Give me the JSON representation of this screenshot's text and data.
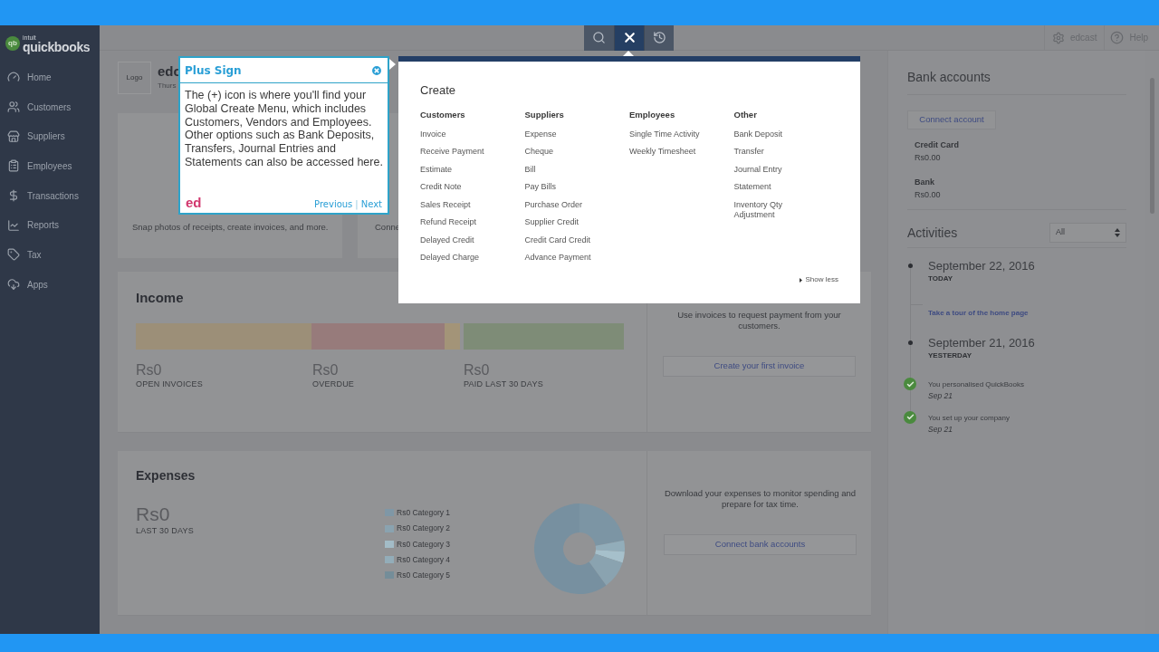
{
  "sidebar": {
    "logo_badge": "qb",
    "logo_small": "intuit",
    "logo": "quickbooks",
    "items": [
      {
        "label": "Home"
      },
      {
        "label": "Customers"
      },
      {
        "label": "Suppliers"
      },
      {
        "label": "Employees"
      },
      {
        "label": "Transactions"
      },
      {
        "label": "Reports"
      },
      {
        "label": "Tax"
      },
      {
        "label": "Apps"
      }
    ]
  },
  "toolbar": {
    "buttons": [
      {
        "kind": "search",
        "selected": false
      },
      {
        "kind": "close",
        "selected": true
      },
      {
        "kind": "recent",
        "selected": false
      }
    ]
  },
  "header": {
    "user": "edcast",
    "help": "Help"
  },
  "company": {
    "logo_label": "Logo",
    "name": "edc",
    "date": "Thurs"
  },
  "cards": [
    {
      "text": "Snap photos of receipts, create invoices, and more."
    },
    {
      "text": "Conne"
    }
  ],
  "income": {
    "title": "Income",
    "stats": [
      {
        "amount": "Rs0",
        "label": "OPEN INVOICES"
      },
      {
        "amount": "Rs0",
        "label": "OVERDUE"
      },
      {
        "amount": "Rs0",
        "label": "PAID LAST 30 DAYS"
      }
    ],
    "prompt": "Use invoices to request payment from your customers.",
    "button": "Create your first invoice"
  },
  "expenses": {
    "title": "Expenses",
    "amount": "Rs0",
    "period": "LAST 30 DAYS",
    "legend": [
      {
        "label": "Rs0 Category 1",
        "color": "#7f97a6"
      },
      {
        "label": "Rs0 Category 2",
        "color": "#8aa3b0"
      },
      {
        "label": "Rs0 Category 3",
        "color": "#a3bcc7"
      },
      {
        "label": "Rs0 Category 4",
        "color": "#93adb9"
      },
      {
        "label": "Rs0 Category 5",
        "color": "#748d99"
      }
    ],
    "prompt": "Download your expenses to monitor spending and prepare for tax time.",
    "button": "Connect bank accounts"
  },
  "create_menu": {
    "title": "Create",
    "columns": [
      {
        "heading": "Customers",
        "items": [
          "Invoice",
          "Receive Payment",
          "Estimate",
          "Credit Note",
          "Sales Receipt",
          "Refund Receipt",
          "Delayed Credit",
          "Delayed Charge"
        ]
      },
      {
        "heading": "Suppliers",
        "items": [
          "Expense",
          "Cheque",
          "Bill",
          "Pay Bills",
          "Purchase Order",
          "Supplier Credit",
          "Credit Card Credit",
          "Advance Payment"
        ]
      },
      {
        "heading": "Employees",
        "items": [
          "Single Time Activity",
          "Weekly Timesheet"
        ]
      },
      {
        "heading": "Other",
        "items": [
          "Bank Deposit",
          "Transfer",
          "Journal Entry",
          "Statement",
          "Inventory Qty Adjustment"
        ]
      }
    ],
    "show_less": "Show less"
  },
  "tour_popup": {
    "title": "Plus Sign",
    "body": "The (+) icon is where you'll find your Global Create Menu, which includes Customers, Vendors and Employees. Other options such as Bank Deposits, Transfers, Journal Entries and Statements can also be accessed here.",
    "brand": "ed",
    "previous": "Previous",
    "separator": "|",
    "next": "Next"
  },
  "bank_accounts": {
    "title": "Bank accounts",
    "button": "Connect account",
    "accounts": [
      {
        "name": "Credit Card",
        "balance": "Rs0.00"
      },
      {
        "name": "Bank",
        "balance": "Rs0.00"
      }
    ]
  },
  "activities": {
    "title": "Activities",
    "filter": "All",
    "entries": [
      {
        "kind": "date",
        "date": "September 22, 2016",
        "caption": "TODAY"
      },
      {
        "kind": "link",
        "text": "Take a tour of the home page"
      },
      {
        "kind": "date",
        "date": "September 21, 2016",
        "caption": "YESTERDAY"
      },
      {
        "kind": "done",
        "text": "You personalised QuickBooks",
        "date": "Sep 21"
      },
      {
        "kind": "done",
        "text": "You set up your company",
        "date": "Sep 21"
      }
    ]
  }
}
